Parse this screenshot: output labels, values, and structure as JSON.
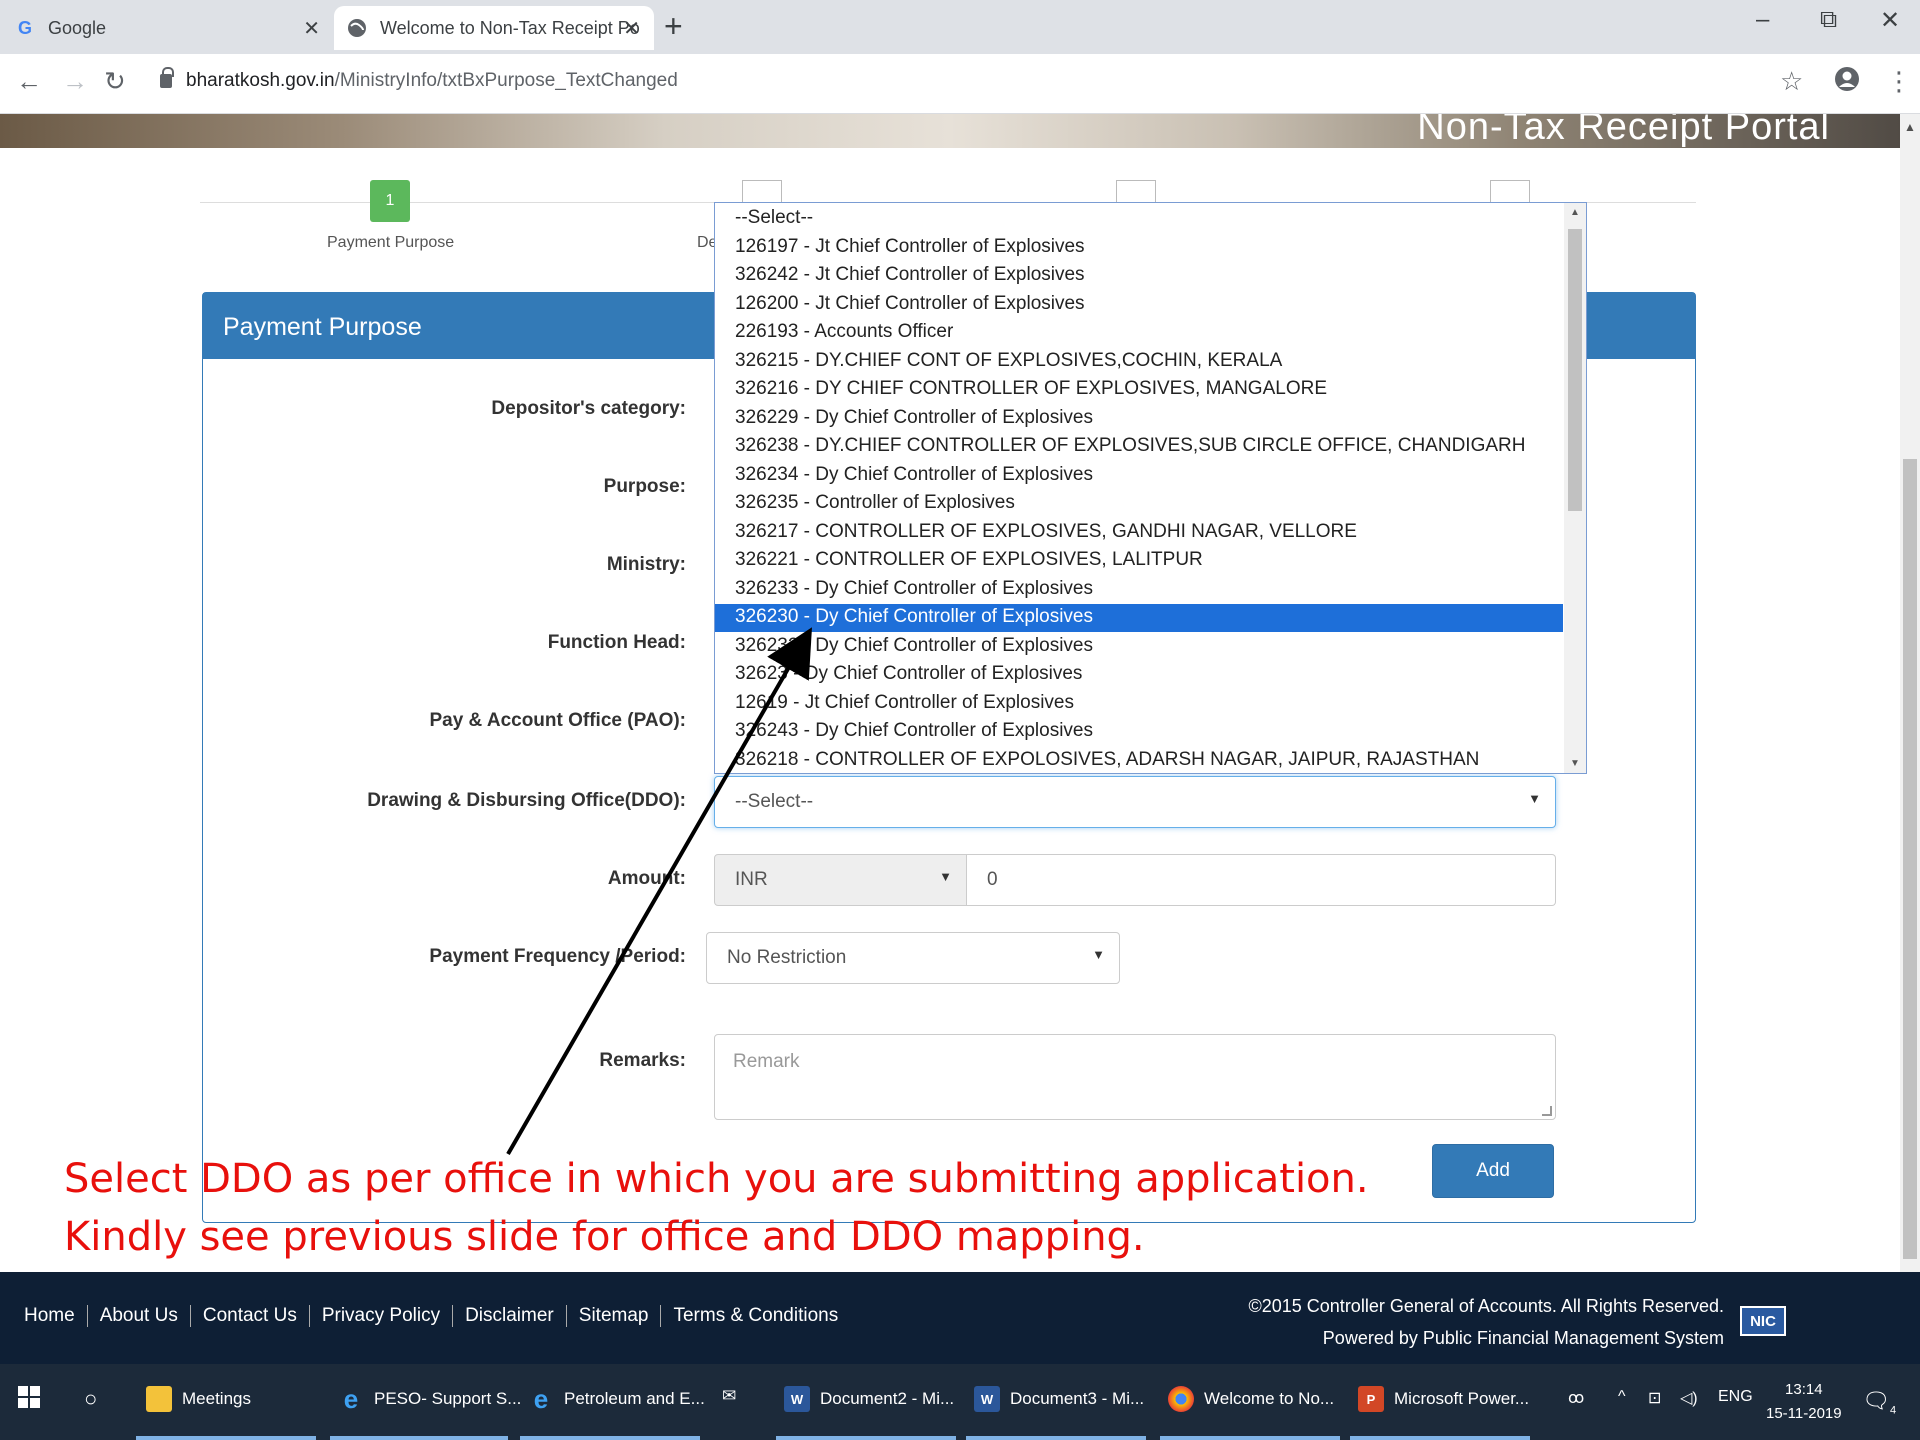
{
  "browser": {
    "tabs": [
      {
        "title": "Google",
        "favicon": "G"
      },
      {
        "title": "Welcome to Non-Tax Receipt Po"
      }
    ],
    "url_host": "bharatkosh.gov.in",
    "url_path": "/MinistryInfo/txtBxPurpose_TextChanged"
  },
  "banner": {
    "title": "Non-Tax Receipt Portal"
  },
  "stepper": {
    "step1_number": "1",
    "step1_label": "Payment Purpose",
    "step2_label_fragment": "De"
  },
  "panel": {
    "title": "Payment Purpose"
  },
  "form": {
    "depositor_label": "Depositor's category:",
    "purpose_label": "Purpose:",
    "ministry_label": "Ministry:",
    "function_head_label": "Function Head:",
    "pao_label": "Pay & Account Office (PAO):",
    "ddo_label": "Drawing & Disbursing Office(DDO):",
    "ddo_value": "--Select--",
    "amount_label": "Amount:",
    "currency_value": "INR",
    "amount_value": "0",
    "frequency_label": "Payment Frequency /Period:",
    "frequency_value": "No Restriction",
    "remarks_label": "Remarks:",
    "remarks_placeholder": "Remark",
    "add_label": "Add"
  },
  "ddo_dropdown": {
    "options": [
      "--Select--",
      "126197 - Jt Chief Controller of Explosives",
      "326242 - Jt Chief Controller of Explosives",
      "126200 - Jt Chief Controller of Explosives",
      "226193 - Accounts Officer",
      "326215 - DY.CHIEF CONT OF EXPLOSIVES,COCHIN, KERALA",
      "326216 - DY CHIEF CONTROLLER OF EXPLOSIVES, MANGALORE",
      "326229 - Dy Chief Controller of Explosives",
      "326238 - DY.CHIEF CONTROLLER OF EXPLOSIVES,SUB CIRCLE OFFICE, CHANDIGARH",
      "326234 - Dy Chief Controller of Explosives",
      "326235 - Controller of Explosives",
      "326217 - CONTROLLER OF EXPLOSIVES, GANDHI NAGAR, VELLORE",
      "326221 - CONTROLLER OF EXPLOSIVES, LALITPUR",
      "326233 - Dy Chief Controller of Explosives",
      "326230 - Dy Chief Controller of Explosives",
      "326232 - Dy Chief Controller of Explosives",
      "32623 - Dy Chief Controller of Explosives",
      "12619 - Jt Chief Controller of Explosives",
      "326243 - Dy Chief Controller of Explosives",
      "326218 - CONTROLLER OF EXPOLOSIVES, ADARSH NAGAR, JAIPUR, RAJASTHAN"
    ],
    "selected_index": 14
  },
  "annotation": {
    "line1": "Select DDO as per office in which you are submitting application.",
    "line2": "Kindly see previous slide for office and DDO mapping.",
    "color": "#e8100c"
  },
  "footer": {
    "links": [
      "Home",
      "About Us",
      "Contact Us",
      "Privacy Policy",
      "Disclaimer",
      "Sitemap",
      "Terms & Conditions"
    ],
    "copyright": "©2015 Controller General of Accounts. All Rights Reserved.",
    "powered": "Powered by  Public Financial Management System",
    "logo_text": "NIC"
  },
  "taskbar": {
    "items": [
      "Meetings",
      "PESO- Support S...",
      "Petroleum and E...",
      "Document2 - Mi...",
      "Document3 - Mi...",
      "Welcome to No...",
      "Microsoft Power..."
    ],
    "lang": "ENG",
    "time": "13:14",
    "date": "15-11-2019",
    "notif_count": "4"
  },
  "colors": {
    "primary": "#337ab7",
    "step_green": "#5cb85c",
    "selected_option": "#1e6fd9",
    "footer_bg": "#0e1f35"
  }
}
